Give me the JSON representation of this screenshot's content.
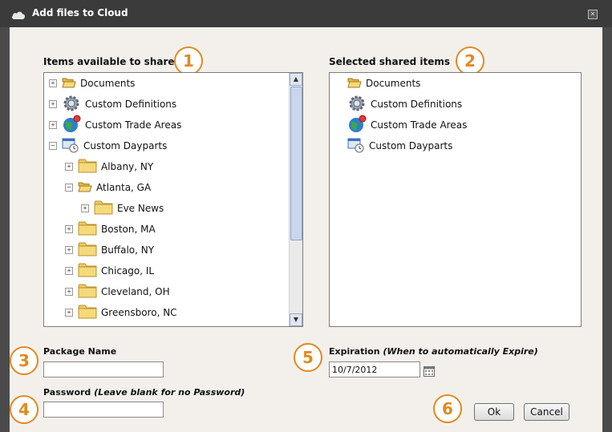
{
  "window": {
    "title": "Add files to Cloud",
    "close_glyph": "✕"
  },
  "left_panel": {
    "label": "Items available to share",
    "items": [
      {
        "label": "Documents",
        "expander": "+",
        "icon": "folder-open-icon"
      },
      {
        "label": "Custom Definitions",
        "expander": "+",
        "icon": "gear-icon"
      },
      {
        "label": "Custom Trade Areas",
        "expander": "+",
        "icon": "globe-icon"
      },
      {
        "label": "Custom Dayparts",
        "expander": "−",
        "icon": "clock-window-icon"
      },
      {
        "label": "Albany, NY",
        "expander": "+",
        "icon": "folder-icon"
      },
      {
        "label": "Atlanta, GA",
        "expander": "−",
        "icon": "folder-open-icon"
      },
      {
        "label": "Eve News",
        "expander": "+",
        "icon": "folder-icon"
      },
      {
        "label": "Boston, MA",
        "expander": "+",
        "icon": "folder-icon"
      },
      {
        "label": "Buffalo, NY",
        "expander": "+",
        "icon": "folder-icon"
      },
      {
        "label": "Chicago, IL",
        "expander": "+",
        "icon": "folder-icon"
      },
      {
        "label": "Cleveland, OH",
        "expander": "+",
        "icon": "folder-icon"
      },
      {
        "label": "Greensboro, NC",
        "expander": "+",
        "icon": "folder-icon"
      }
    ]
  },
  "right_panel": {
    "label": "Selected shared items",
    "items": [
      {
        "label": "Documents",
        "icon": "folder-open-icon"
      },
      {
        "label": "Custom Definitions",
        "icon": "gear-icon"
      },
      {
        "label": "Custom Trade Areas",
        "icon": "globe-icon"
      },
      {
        "label": "Custom Dayparts",
        "icon": "clock-window-icon"
      }
    ]
  },
  "form": {
    "package_name_label": "Package Name",
    "package_name_value": "",
    "password_label": "Password",
    "password_hint": "(Leave blank for no Password)",
    "password_value": "",
    "expiration_label": "Expiration",
    "expiration_hint": "(When to automatically Expire)",
    "expiration_value": "10/7/2012"
  },
  "buttons": {
    "ok": "Ok",
    "cancel": "Cancel"
  },
  "badges": [
    "1",
    "2",
    "3",
    "4",
    "5",
    "6"
  ],
  "colors": {
    "badge": "#e08a1e",
    "titlebar": "#3b3b3b",
    "content_bg": "#f3f0ec"
  }
}
